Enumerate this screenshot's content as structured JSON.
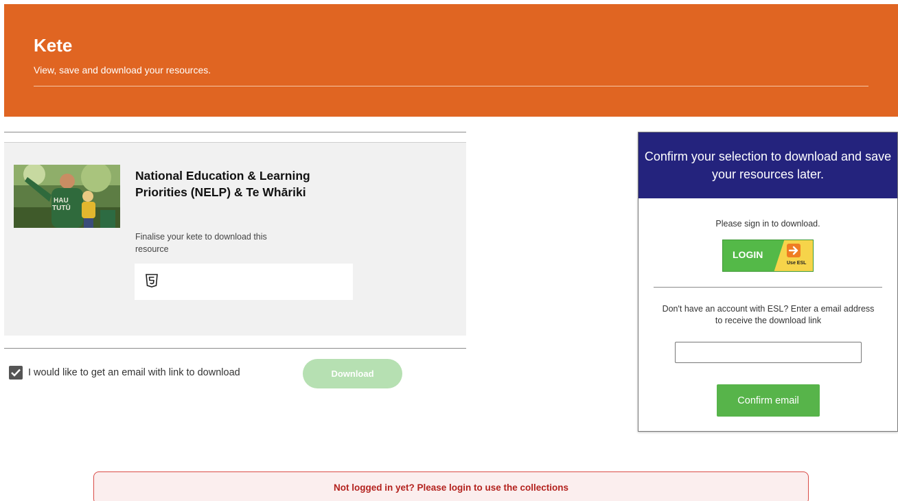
{
  "hero": {
    "title": "Kete",
    "subtitle": "View, save and download your resources."
  },
  "resource": {
    "title": "National Education & Learning Priorities (NELP) & Te Whāriki",
    "note": "Finalise your kete to download this resource",
    "format_icon": "html5-icon",
    "thumbnail_icon": "photo-thumbnail"
  },
  "email_option": {
    "label": "I would like to get an email with link to download",
    "checked": true
  },
  "download_button": "Download",
  "panel": {
    "heading": "Confirm your selection to download and save your resources later.",
    "sign_in_text": "Please sign in to download.",
    "login_label": "LOGIN",
    "login_badge": "Use ESL",
    "no_account_text": "Don't have an account with ESL? Enter a email address to receive the download link",
    "email_value": "",
    "email_placeholder": "",
    "confirm_label": "Confirm email"
  },
  "notice": "Not logged in yet? Please login to use the collections",
  "colors": {
    "hero": "#e06522",
    "panel_head": "#24237d",
    "green": "#57b44a",
    "download_disabled": "#b6e0b2",
    "notice_text": "#b3221e"
  }
}
